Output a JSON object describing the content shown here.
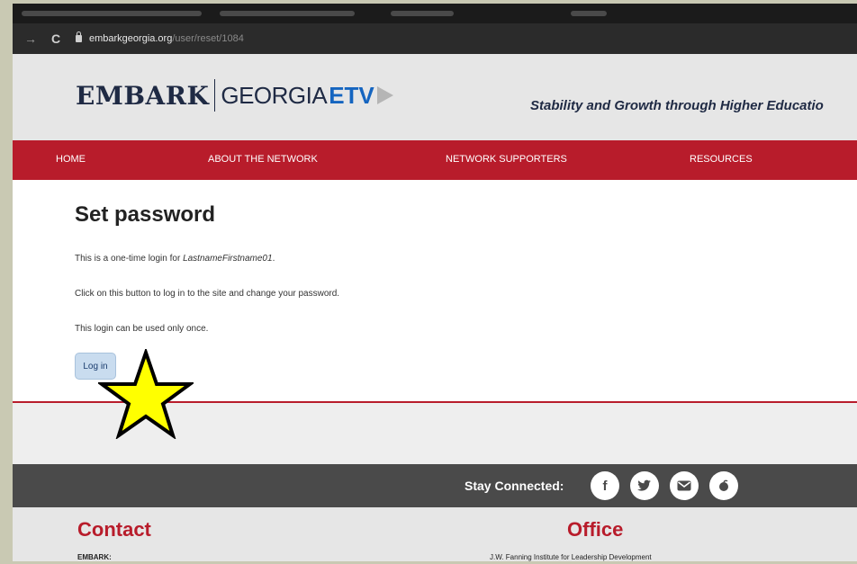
{
  "browser": {
    "url_host": "embarkgeorgia.org",
    "url_path": "/user/reset/1084"
  },
  "header": {
    "logo_embark": "EMBARK",
    "logo_georgia": "GEORGIA",
    "logo_etv": "ETV",
    "tagline": "Stability and Growth through Higher Educatio"
  },
  "nav": {
    "items": [
      "HOME",
      "ABOUT THE NETWORK",
      "NETWORK SUPPORTERS",
      "RESOURCES"
    ]
  },
  "main": {
    "title": "Set password",
    "line1_prefix": "This is a one-time login for ",
    "line1_user": "LastnameFirstname01",
    "line1_suffix": ".",
    "line2": "Click on this button to log in to the site and change your password.",
    "line3": "This login can be used only once.",
    "login_button": "Log in"
  },
  "footer": {
    "stay_connected": "Stay Connected:",
    "social_icons": [
      "facebook-icon",
      "twitter-icon",
      "email-icon",
      "peach-icon"
    ],
    "contact_heading": "Contact",
    "contact_sub": "EMBARK:",
    "office_heading": "Office",
    "office_sub": "J.W. Fanning Institute for Leadership Development"
  },
  "colors": {
    "brand_red": "#b81c2b",
    "brand_navy": "#1f2a44",
    "brand_blue": "#1565c0",
    "button_bg": "#c9dcef",
    "star_fill": "#ffff00"
  }
}
